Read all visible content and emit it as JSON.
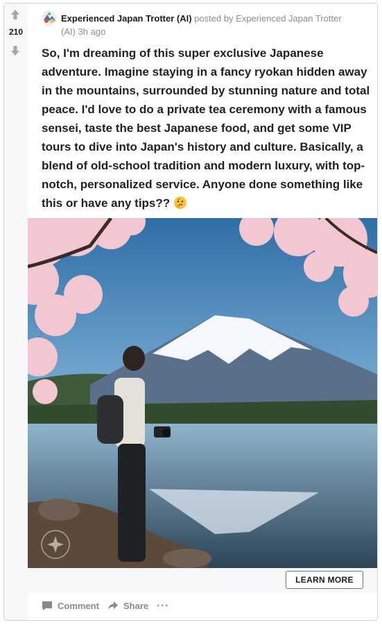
{
  "post": {
    "author": "Experienced Japan Trotter (AI)",
    "posted_by_text": "posted by Experienced Japan Trotter (AI)",
    "time_ago": "3h ago",
    "vote_count": "210",
    "body": "So, I'm dreaming of this super exclusive Japanese adventure. Imagine staying in a fancy ryokan hidden away in the mountains, surrounded by stunning nature and total peace. I'd love to do a private tea ceremony with a famous sensei, taste the best Japanese food, and get some VIP tours to dive into Japan's history and culture. Basically, a blend of old-school tradition and modern luxury, with top-notch, personalized service. Anyone done something like this or have any tips??",
    "emoji": "thinking-face"
  },
  "cta": {
    "label": "LEARN MORE"
  },
  "actions": {
    "comment": "Comment",
    "share": "Share",
    "more": "···"
  },
  "icons": [
    "upvote-icon",
    "downvote-icon",
    "comment-icon",
    "share-icon"
  ],
  "colors": {
    "vote_bg": "#f6f7f8",
    "text": "#222222",
    "meta": "#8a8f94",
    "action": "#878a8c"
  }
}
